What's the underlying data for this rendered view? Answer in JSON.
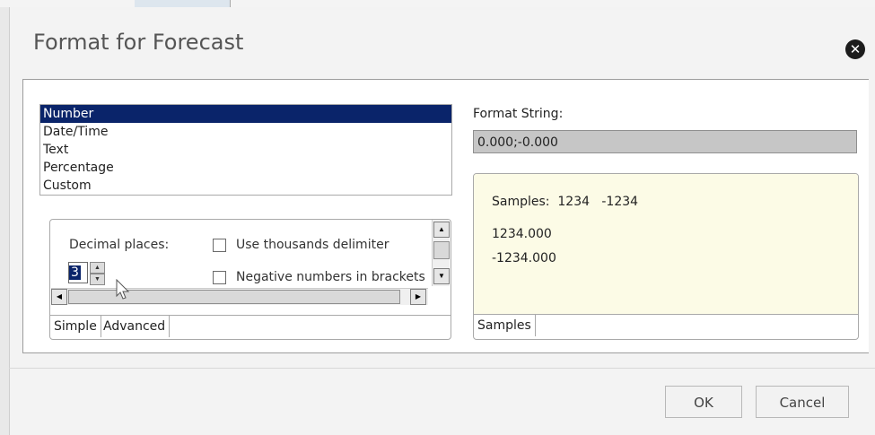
{
  "dialog": {
    "title": "Format for Forecast",
    "close_icon": "close-icon"
  },
  "format_types": {
    "items": [
      "Number",
      "Date/Time",
      "Text",
      "Percentage",
      "Custom"
    ],
    "selected": "Number"
  },
  "options": {
    "decimal_places_label": "Decimal places:",
    "decimal_places_value": "3",
    "thousands_label": "Use thousands delimiter",
    "thousands_checked": false,
    "brackets_label": "Negative numbers in brackets",
    "brackets_checked": false,
    "tabs": [
      "Simple",
      "Advanced"
    ]
  },
  "format_string": {
    "label": "Format String:",
    "value": "0.000;-0.000"
  },
  "samples": {
    "header": "Samples:  1234   -1234",
    "positive": "1234.000",
    "negative": "-1234.000",
    "tab": "Samples"
  },
  "buttons": {
    "ok": "OK",
    "cancel": "Cancel"
  },
  "colors": {
    "selection": "#0a246a",
    "samples_bg": "#fcfbe6",
    "format_box_bg": "#c6c6c6"
  }
}
